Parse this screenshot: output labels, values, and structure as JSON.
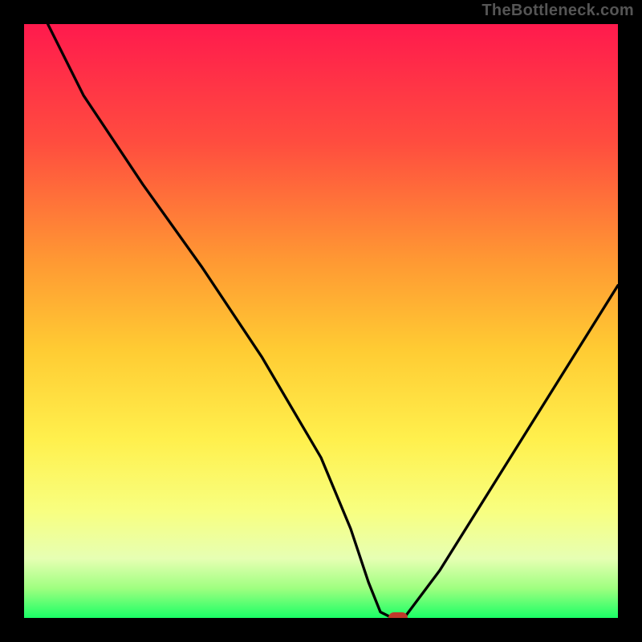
{
  "watermark": "TheBottleneck.com",
  "colors": {
    "black": "#000000",
    "curve": "#000000",
    "marker": "#c0392b",
    "gradient_stops": [
      {
        "offset": 0.0,
        "color": "#ff1a4d"
      },
      {
        "offset": 0.2,
        "color": "#ff4d3f"
      },
      {
        "offset": 0.4,
        "color": "#ff9933"
      },
      {
        "offset": 0.55,
        "color": "#ffcc33"
      },
      {
        "offset": 0.7,
        "color": "#fff04d"
      },
      {
        "offset": 0.82,
        "color": "#f8ff80"
      },
      {
        "offset": 0.9,
        "color": "#e6ffb3"
      },
      {
        "offset": 0.95,
        "color": "#9fff80"
      },
      {
        "offset": 1.0,
        "color": "#1aff66"
      }
    ]
  },
  "chart_data": {
    "type": "line",
    "title": "",
    "xlabel": "",
    "ylabel": "",
    "xlim": [
      0,
      100
    ],
    "ylim": [
      0,
      100
    ],
    "series": [
      {
        "name": "curve",
        "x": [
          4,
          10,
          20,
          30,
          40,
          50,
          55,
          58,
          60,
          62,
          64,
          70,
          80,
          90,
          100
        ],
        "values": [
          100,
          88,
          73,
          59,
          44,
          27,
          15,
          6,
          1,
          0,
          0,
          8,
          24,
          40,
          56
        ]
      }
    ],
    "marker": {
      "x": 63,
      "y": 0
    }
  }
}
